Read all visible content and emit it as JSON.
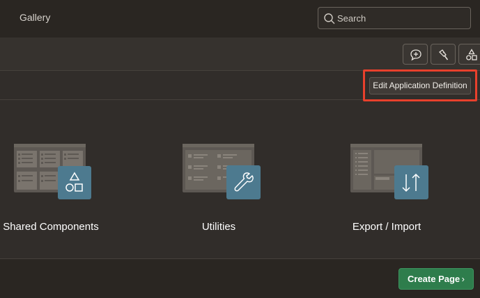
{
  "header": {
    "title": "Gallery",
    "search_placeholder": "Search"
  },
  "toolbar": {
    "icons": [
      "chat-add-icon",
      "flashlight-icon",
      "shapes-icon"
    ]
  },
  "actions": {
    "edit_label": "Edit Application Definition"
  },
  "tiles": [
    {
      "label": "Shared Components",
      "icon": "shapes-icon"
    },
    {
      "label": "Utilities",
      "icon": "wrench-icon"
    },
    {
      "label": "Export / Import",
      "icon": "arrows-updown-icon"
    }
  ],
  "footer": {
    "create_label": "Create Page",
    "create_chevron": "›"
  },
  "colors": {
    "accent_highlight": "#e8402c",
    "primary": "#2e7d4c",
    "tile_badge": "#4d7a8f",
    "background": "#312d2a"
  }
}
